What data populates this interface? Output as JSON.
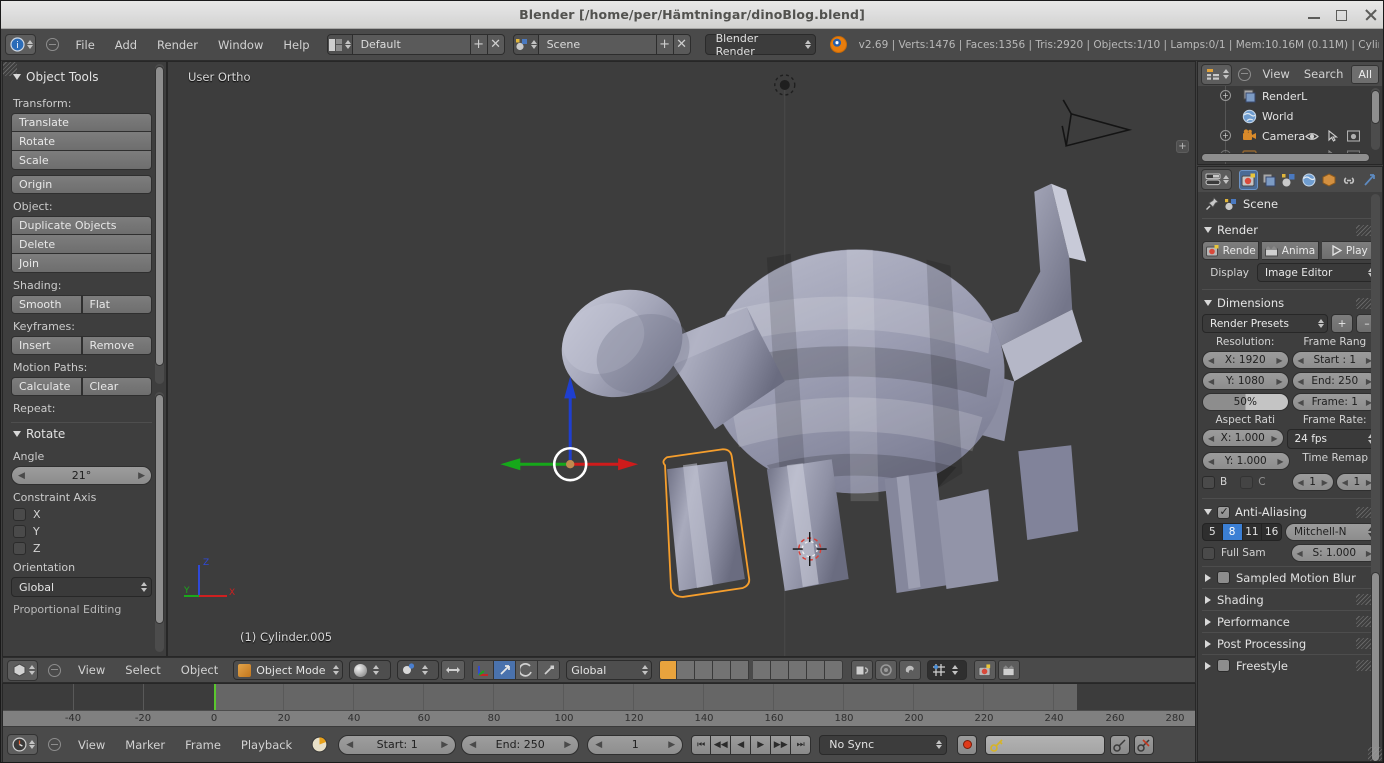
{
  "window": {
    "title": "Blender [/home/per/Hämtningar/dinoBlog.blend]",
    "minimize": "–",
    "maximize": "□",
    "close": "×"
  },
  "topbar": {
    "menus": [
      "File",
      "Add",
      "Render",
      "Window",
      "Help"
    ],
    "screen_layout": "Default",
    "scene_name": "Scene",
    "render_engine": "Blender Render",
    "stats": "v2.69 | Verts:1476 | Faces:1356 | Tris:2920 | Objects:1/10 | Lamps:0/1 | Mem:10.16M (0.11M) | Cylinder",
    "plus_label": "+",
    "x_label": "✕"
  },
  "toolshelf": {
    "panel_title": "Object Tools",
    "groups": [
      {
        "label": "Transform:",
        "buttons": [
          "Translate",
          "Rotate",
          "Scale"
        ]
      },
      {
        "label": "",
        "buttons": [
          "Origin"
        ]
      },
      {
        "label": "Object:",
        "buttons": [
          "Duplicate Objects",
          "Delete",
          "Join"
        ]
      },
      {
        "label": "Shading:",
        "buttons": [
          "Smooth",
          "Flat"
        ]
      },
      {
        "label": "Keyframes:",
        "buttons": [
          "Insert",
          "Remove"
        ]
      },
      {
        "label": "Motion Paths:",
        "buttons": [
          "Calculate",
          "Clear"
        ]
      },
      {
        "label": "Repeat:",
        "buttons": []
      }
    ],
    "rotate_panel": {
      "title": "Rotate",
      "angle_label": "Angle",
      "angle_value": "21°",
      "constraint_label": "Constraint Axis",
      "axes": [
        "X",
        "Y",
        "Z"
      ],
      "orientation_label": "Orientation",
      "orientation_value": "Global",
      "proportional_label": "Proportional Editing"
    }
  },
  "viewport": {
    "view_name": "User Ortho",
    "object_label": "(1) Cylinder.005",
    "axis_x": "X",
    "axis_y": "Y",
    "axis_z": "Z",
    "background_color": "#3d3d3d",
    "mesh_color": "#9a9cb0",
    "selected_outline_color": "#f59e2d"
  },
  "viewport_header": {
    "menus": [
      "View",
      "Select",
      "Object"
    ],
    "mode": "Object Mode",
    "transform_orientation": "Global"
  },
  "timeline": {
    "menus": [
      "View",
      "Marker",
      "Frame",
      "Playback"
    ],
    "start_label": "Start: 1",
    "end_label": "End: 250",
    "current_frame": "1",
    "sync_mode": "No Sync",
    "ruler_ticks": [
      "-40",
      "-20",
      "0",
      "20",
      "40",
      "60",
      "80",
      "100",
      "120",
      "140",
      "160",
      "180",
      "200",
      "220",
      "240",
      "260",
      "280"
    ],
    "transport": [
      "⏮",
      "◀◀",
      "◀",
      "▶",
      "▶▶",
      "⏭"
    ]
  },
  "outliner": {
    "menus": [
      "View",
      "Search"
    ],
    "filter": "All",
    "items": [
      {
        "label": "RenderL",
        "icon": "renderlayer-icon",
        "expandable": true
      },
      {
        "label": "World",
        "icon": "world-icon",
        "expandable": false
      },
      {
        "label": "Camera",
        "icon": "camera-icon",
        "expandable": true
      }
    ]
  },
  "properties": {
    "breadcrumb": "Scene",
    "tabs": [
      "render-tab",
      "renderlayers-tab",
      "scene-tab",
      "world-tab",
      "object-tab",
      "constraints-tab",
      "modifiers-tab"
    ],
    "render": {
      "title": "Render",
      "render_button": "Rende",
      "animation_button": "Anima",
      "play_button": "Play",
      "display_label": "Display",
      "display_value": "Image Editor"
    },
    "dimensions": {
      "title": "Dimensions",
      "presets_label": "Render Presets",
      "resolution_label": "Resolution:",
      "res_x": "X: 1920",
      "res_y": "Y: 1080",
      "res_percent": "50%",
      "frame_range_label": "Frame Rang",
      "start": "Start : 1",
      "end": "End: 250",
      "frame_step": "Frame: 1",
      "aspect_label": "Aspect Rati",
      "aspect_x": "X: 1.000",
      "aspect_y": "Y: 1.000",
      "border_label": "B",
      "crop_label": "C",
      "frame_rate_label": "Frame Rate:",
      "frame_rate": "24 fps",
      "time_remap_label": "Time Remap",
      "remap_old": "1",
      "remap_new": "1"
    },
    "antialiasing": {
      "title": "Anti-Aliasing",
      "samples": [
        "5",
        "8",
        "11",
        "16"
      ],
      "active_sample": "8",
      "filter": "Mitchell-N",
      "full_sample_label": "Full Sam",
      "size_value": "S: 1.000"
    },
    "closed_sections": [
      {
        "label": "Sampled Motion Blur",
        "checkbox": true
      },
      {
        "label": "Shading",
        "checkbox": false
      },
      {
        "label": "Performance",
        "checkbox": false
      },
      {
        "label": "Post Processing",
        "checkbox": false
      },
      {
        "label": "Freestyle",
        "checkbox": true
      }
    ]
  }
}
